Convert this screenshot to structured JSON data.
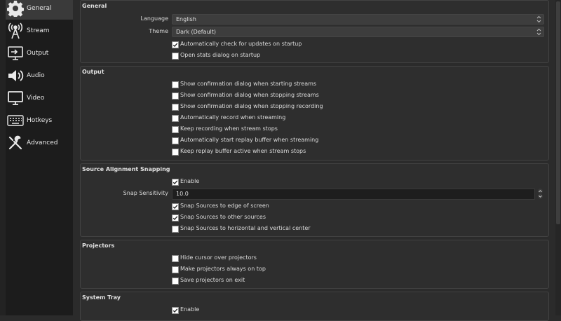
{
  "sidebar": {
    "items": [
      {
        "label": "General",
        "icon": "gear-icon",
        "active": true
      },
      {
        "label": "Stream",
        "icon": "antenna-icon"
      },
      {
        "label": "Output",
        "icon": "output-monitor-icon"
      },
      {
        "label": "Audio",
        "icon": "speaker-icon"
      },
      {
        "label": "Video",
        "icon": "monitor-icon"
      },
      {
        "label": "Hotkeys",
        "icon": "keyboard-icon"
      },
      {
        "label": "Advanced",
        "icon": "tools-icon"
      }
    ]
  },
  "general": {
    "title": "General",
    "language_label": "Language",
    "language_value": "English",
    "theme_label": "Theme",
    "theme_value": "Dark (Default)",
    "checks": [
      {
        "label": "Automatically check for updates on startup",
        "checked": true
      },
      {
        "label": "Open stats dialog on startup",
        "checked": false
      }
    ]
  },
  "output": {
    "title": "Output",
    "checks": [
      {
        "label": "Show confirmation dialog when starting streams",
        "checked": false
      },
      {
        "label": "Show confirmation dialog when stopping streams",
        "checked": false
      },
      {
        "label": "Show confirmation dialog when stopping recording",
        "checked": false
      },
      {
        "label": "Automatically record when streaming",
        "checked": false
      },
      {
        "label": "Keep recording when stream stops",
        "checked": false
      },
      {
        "label": "Automatically start replay buffer when streaming",
        "checked": false
      },
      {
        "label": "Keep replay buffer active when stream stops",
        "checked": false
      }
    ]
  },
  "snapping": {
    "title": "Source Alignment Snapping",
    "enable": {
      "label": "Enable",
      "checked": true
    },
    "sensitivity_label": "Snap Sensitivity",
    "sensitivity_value": "10.0",
    "checks": [
      {
        "label": "Snap Sources to edge of screen",
        "checked": true
      },
      {
        "label": "Snap Sources to other sources",
        "checked": true
      },
      {
        "label": "Snap Sources to horizontal and vertical center",
        "checked": false
      }
    ]
  },
  "projectors": {
    "title": "Projectors",
    "checks": [
      {
        "label": "Hide cursor over projectors",
        "checked": false
      },
      {
        "label": "Make projectors always on top",
        "checked": false
      },
      {
        "label": "Save projectors on exit",
        "checked": false
      }
    ]
  },
  "system_tray": {
    "title": "System Tray",
    "enable": {
      "label": "Enable",
      "checked": true
    }
  },
  "colors": {
    "sidebar_bg": "#1c1c1c",
    "sidebar_active": "#3a3a3a",
    "content_bg": "#2b2b2b",
    "group_border": "#424242"
  }
}
